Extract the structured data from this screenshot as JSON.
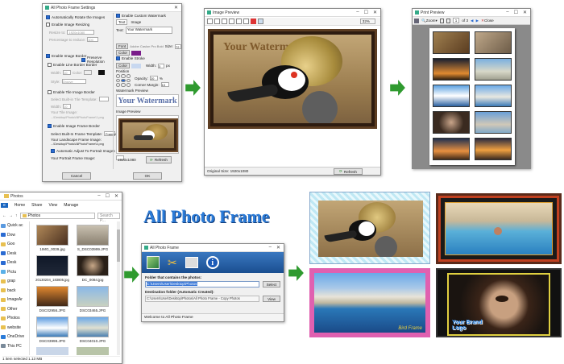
{
  "settings": {
    "title": "All Photo Frame Settings",
    "auto_rotate": "Automatically Rotate the Images",
    "enable_resizing": "Enable Image Resizing",
    "resize_to": "Resize to:",
    "resize_value": "1920x1080",
    "percentage": "Percentage to reduce:",
    "percentage_value": "100",
    "enable_border": "Enable Image Border",
    "preserve_resolution": "Preserve Resolution",
    "enable_line_border": "Enable Line Border Border",
    "width": "Width:",
    "width_value": "10",
    "color": "Color:",
    "style": "Style:",
    "style_value": "Groove",
    "enable_tile": "Enable Tile Image Border",
    "select_tile": "Select Built-in Tile Template:",
    "your_tile": "Your Tile Image:",
    "tile_path": "...\\Desktop\\Photo\\AllPhotoFrame\\1.png",
    "enable_frame": "Enable Image Frame Border",
    "select_frame": "Select Built-In Frame Template:",
    "frame_value": "Frame4",
    "landscape": "Your Landscape Frame Image:",
    "landscape_path": "...\\Desktop\\Photo\\AllPhotoFrame\\4.png",
    "auto_adjust": "Automatic Adjust To Portrait Images",
    "portrait": "Your Portrait Frame Image:",
    "enable_watermark": "Enable Custom Watermark",
    "text_label": "Text",
    "image_label": "Image",
    "text_field_label": "Text:",
    "text_value": "Your Watermark",
    "font_label": "Font",
    "font_value": "Adobe Caslon Pro Bold",
    "size_label": "Size:",
    "size_value": "72",
    "color_label": "Color",
    "enable_stroke": "Enable Stroke",
    "stroke_color": "Color",
    "stroke_width_label": "Width:",
    "stroke_width_value": "3",
    "px": "px",
    "position_label": "Position",
    "opacity_label": "Opacity:",
    "opacity_value": "20",
    "pct": "%",
    "corner_label": "Corner Margin:",
    "corner_value": "10",
    "watermark_preview_label": "Watermark Preview",
    "watermark_preview_text": "Your Watermark",
    "image_preview_label": "Image Preview",
    "resolution": "1920x1080",
    "refresh": "Refresh",
    "cancel": "Cancel",
    "ok": "OK"
  },
  "image_preview": {
    "title": "Image Preview",
    "zoom": "32%",
    "watermark": "Your Watermark",
    "original_size": "Original Size: 1920x1080",
    "refresh": "Refresh"
  },
  "print_preview": {
    "title": "Print Preview",
    "zoom": "Zoom",
    "page": "1",
    "of": "of 3",
    "close": "Close"
  },
  "explorer": {
    "title": "Photos",
    "tabs": [
      "e",
      "Home",
      "Share",
      "View",
      "Manage"
    ],
    "address": "Photos",
    "search_placeholder": "Search P...",
    "nav_items": [
      "Quick ac",
      "Dow",
      "Goo",
      "Desk",
      "Desk",
      "Pictu",
      "grap",
      "back",
      "ImageAr",
      "Other",
      "Photos",
      "website",
      "OneDrive",
      "This PC"
    ],
    "files": [
      "1IMG_0039.jpg",
      "S_DSC03999.JPG",
      "20130204_183805.jpg",
      "DC_0084.jpg",
      "DSC02956.JPG",
      "DSC03465.JPG",
      "DSC03998.JPG",
      "DSC04010.JPG"
    ],
    "status": "1 item selected  1.13 MB"
  },
  "app_title": "All Photo Frame",
  "main": {
    "title": "All Photo Frame",
    "folder_label": "Folder that contains the photos:",
    "folder_value": "C:\\Users\\User\\Desktop\\Photos",
    "select": "Select",
    "dest_label": "Destination folder (Automatic Created):",
    "dest_value": "C:\\Users\\User\\Desktop\\Photos\\All Photo Frame - Copy Photos",
    "view": "View",
    "welcome": "Welcome to All Photo Frame"
  },
  "results": {
    "watermark1": "Bird Frame",
    "watermark2": "Your Brand Logo"
  },
  "colors": {
    "accent": "#2a6bd2",
    "arrow": "#2f9a2f",
    "title_blue": "#2a7bd8"
  }
}
